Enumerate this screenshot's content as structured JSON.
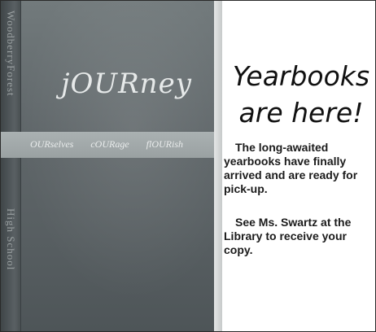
{
  "photo": {
    "book_title": "jOURney",
    "spine_text_top": "WoodberryForest",
    "spine_text_bottom": "High School",
    "band_words": [
      "OURselves",
      "cOURage",
      "flOURish"
    ]
  },
  "announcement": {
    "headline_line1": "Yearbooks",
    "headline_line2": "are here!",
    "paragraph1": "The long-awaited yearbooks have finally arrived and are ready for pick-up.",
    "paragraph2": "See Ms. Swartz at the Library to receive your copy."
  }
}
